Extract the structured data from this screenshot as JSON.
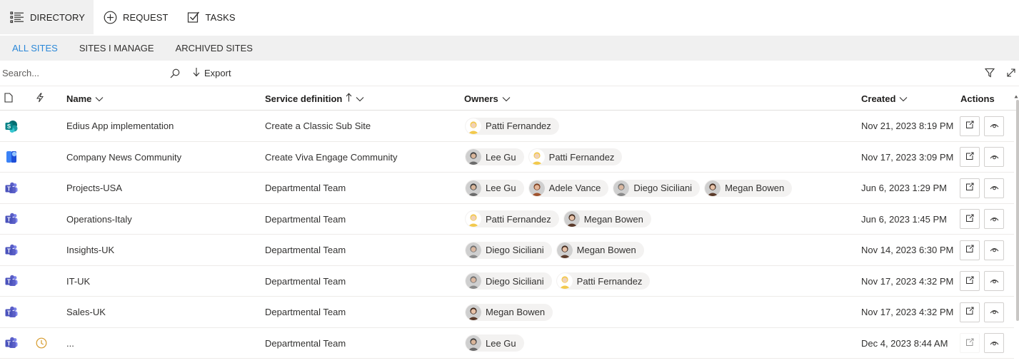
{
  "topnav": [
    {
      "label": "DIRECTORY",
      "icon": "list-icon",
      "active": true
    },
    {
      "label": "REQUEST",
      "icon": "add-circle-icon",
      "active": false
    },
    {
      "label": "TASKS",
      "icon": "checkbox-icon",
      "active": false
    }
  ],
  "subtabs": [
    {
      "label": "ALL SITES",
      "active": true
    },
    {
      "label": "SITES I MANAGE",
      "active": false
    },
    {
      "label": "ARCHIVED SITES",
      "active": false
    }
  ],
  "toolbar": {
    "search_placeholder": "Search...",
    "export_label": "Export"
  },
  "columns": {
    "name": "Name",
    "service": "Service definition",
    "owners": "Owners",
    "created": "Created",
    "actions": "Actions"
  },
  "people": {
    "patti": {
      "name": "Patti Fernandez",
      "color": "#f2c94c"
    },
    "lee": {
      "name": "Lee Gu",
      "color": "#6b6b6b"
    },
    "adele": {
      "name": "Adele Vance",
      "color": "#a0522d"
    },
    "diego": {
      "name": "Diego Siciliani",
      "color": "#8a8a8a"
    },
    "megan": {
      "name": "Megan Bowen",
      "color": "#5a3a2a"
    }
  },
  "rows": [
    {
      "type_icon": "sharepoint-icon",
      "pending": false,
      "name": "Edius App implementation",
      "service": "Create a Classic Sub Site",
      "owners": [
        "Patti Fernandez"
      ],
      "created": "Nov 21, 2023 8:19 PM",
      "edit_disabled": false
    },
    {
      "type_icon": "viva-engage-icon",
      "pending": false,
      "name": "Company News Community",
      "service": "Create Viva Engage Community",
      "owners": [
        "Lee Gu",
        "Patti Fernandez"
      ],
      "created": "Nov 17, 2023 3:09 PM",
      "edit_disabled": false
    },
    {
      "type_icon": "teams-icon",
      "pending": false,
      "name": "Projects-USA",
      "service": "Departmental Team",
      "owners": [
        "Lee Gu",
        "Adele Vance",
        "Diego Siciliani",
        "Megan Bowen"
      ],
      "created": "Jun 6, 2023 1:29 PM",
      "edit_disabled": false
    },
    {
      "type_icon": "teams-icon",
      "pending": false,
      "name": "Operations-Italy",
      "service": "Departmental Team",
      "owners": [
        "Patti Fernandez",
        "Megan Bowen"
      ],
      "created": "Jun 6, 2023 1:45 PM",
      "edit_disabled": false
    },
    {
      "type_icon": "teams-icon",
      "pending": false,
      "name": "Insights-UK",
      "service": "Departmental Team",
      "owners": [
        "Diego Siciliani",
        "Megan Bowen"
      ],
      "created": "Nov 14, 2023 6:30 PM",
      "edit_disabled": false
    },
    {
      "type_icon": "teams-icon",
      "pending": false,
      "name": "IT-UK",
      "service": "Departmental Team",
      "owners": [
        "Diego Siciliani",
        "Patti Fernandez"
      ],
      "created": "Nov 17, 2023 4:32 PM",
      "edit_disabled": false
    },
    {
      "type_icon": "teams-icon",
      "pending": false,
      "name": "Sales-UK",
      "service": "Departmental Team",
      "owners": [
        "Megan Bowen"
      ],
      "created": "Nov 17, 2023 4:32 PM",
      "edit_disabled": false
    },
    {
      "type_icon": "teams-icon",
      "pending": true,
      "name": "...",
      "service": "Departmental Team",
      "owners": [
        "Lee Gu"
      ],
      "created": "Dec 4, 2023 8:44 AM",
      "edit_disabled": true
    }
  ],
  "colors": {
    "accent": "#2b88d8",
    "teams": "#5b5fc7",
    "sharepoint": "#038387",
    "pending": "#d69b2d",
    "chip_bg": "#f3f2f1",
    "subtabs_bg": "#f0f0f0"
  }
}
